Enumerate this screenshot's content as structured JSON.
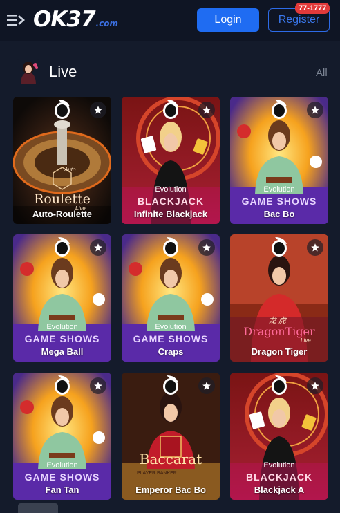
{
  "header": {
    "logo": {
      "main": "OK",
      "num": "37",
      "suffix": ".com"
    },
    "login_label": "Login",
    "register_label": "Register",
    "register_badge": "77-1777"
  },
  "section": {
    "title": "Live",
    "all_label": "All"
  },
  "cards": [
    {
      "name": "Auto-Roulette",
      "art_title": "Roulette",
      "art_sub": "Live",
      "art_top": "Auto"
    },
    {
      "name": "Infinite Blackjack",
      "brand": "Evolution",
      "tag": "BLACKJACK"
    },
    {
      "name": "Bac Bo",
      "brand": "Evolution",
      "tag": "GAME SHOWS"
    },
    {
      "name": "Mega Ball",
      "brand": "Evolution",
      "tag": "GAME SHOWS"
    },
    {
      "name": "Craps",
      "brand": "Evolution",
      "tag": "GAME SHOWS"
    },
    {
      "name": "Dragon Tiger",
      "art_title": "DragonTiger",
      "art_sub": "Live",
      "art_top": "龙 虎"
    },
    {
      "name": "Fan Tan",
      "brand": "Evolution",
      "tag": "GAME SHOWS"
    },
    {
      "name": "Emperor Bac Bo",
      "art_title": "Baccarat",
      "art_top": "PLAYER  BANKER"
    },
    {
      "name": "Blackjack A",
      "brand": "Evolution",
      "tag": "BLACKJACK"
    }
  ],
  "colors": {
    "background": "#141b2b",
    "accent_blue": "#1f6cf2",
    "badge_red": "#e23a3a",
    "game_shows_text": "#e7d4ff",
    "blackjack_text": "#ffd9e6"
  }
}
